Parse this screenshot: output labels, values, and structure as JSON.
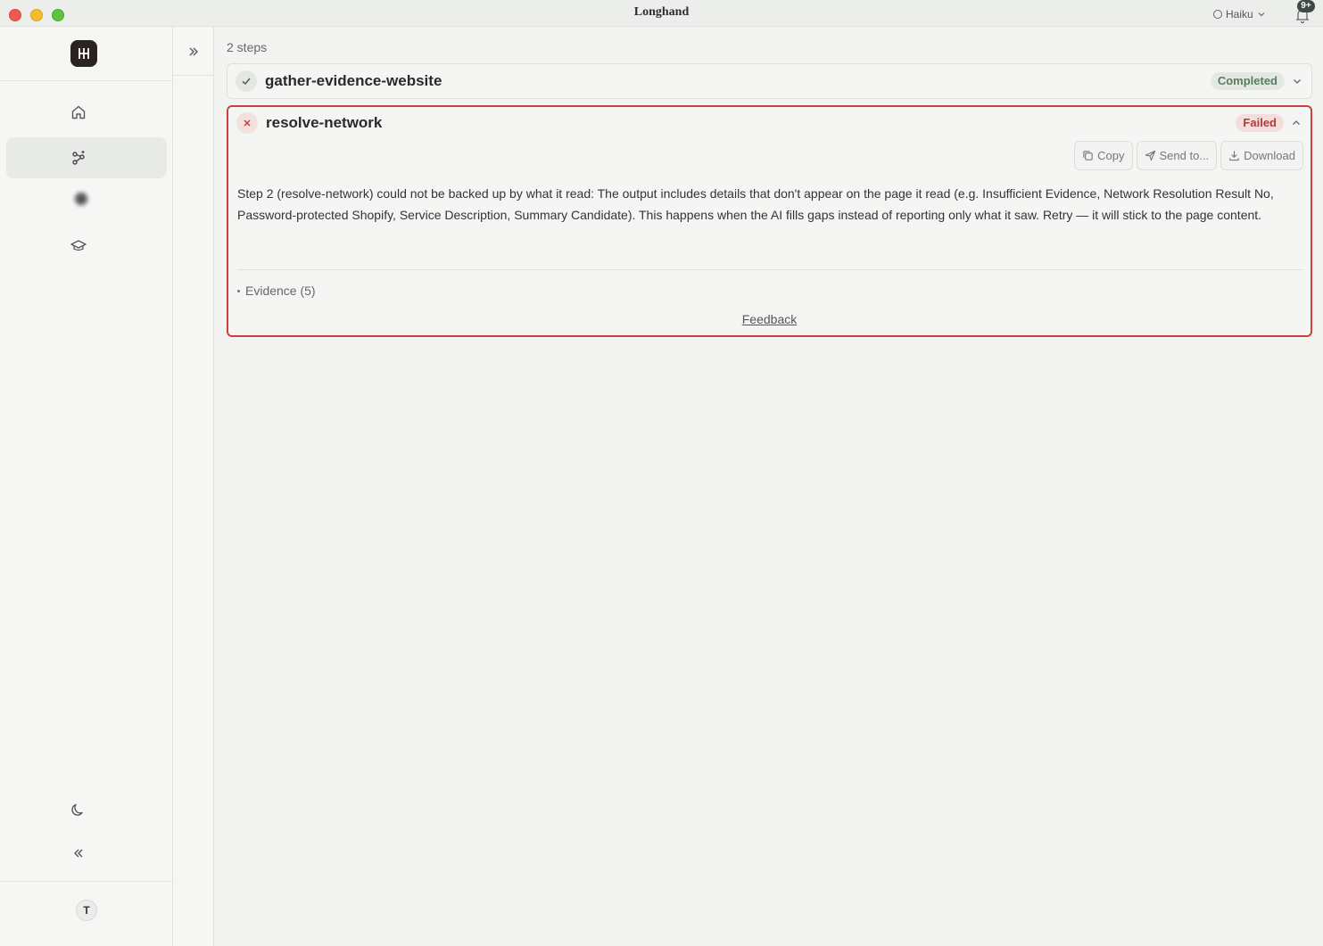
{
  "window": {
    "title": "Longhand",
    "model_selector": "Haiku",
    "notifications_badge": "9+"
  },
  "sidebar": {
    "logo_icon": "longhand-logo",
    "items": [
      {
        "name": "home",
        "icon": "home-icon",
        "active": false
      },
      {
        "name": "workflows",
        "icon": "sparkle-network-icon",
        "active": true
      },
      {
        "name": "blurred",
        "icon": "blurred-icon",
        "active": false
      },
      {
        "name": "learn",
        "icon": "graduation-cap-icon",
        "active": false
      }
    ],
    "theme_toggle_icon": "moon-icon",
    "collapse_icon": "chevrons-left-icon",
    "avatar_initial": "T"
  },
  "main": {
    "steps_count": "2 steps",
    "steps": [
      {
        "name": "gather-evidence-website",
        "status": "Completed",
        "expanded": false
      },
      {
        "name": "resolve-network",
        "status": "Failed",
        "expanded": true,
        "actions": {
          "copy": "Copy",
          "send": "Send to...",
          "download": "Download"
        },
        "error_message": "Step 2 (resolve-network) could not be backed up by what it read: The output includes details that don't appear on the page it read (e.g. Insufficient Evidence, Network Resolution Result No, Password-protected Shopify, Service Description, Summary Candidate). This happens when the AI fills gaps instead of reporting only what it saw. Retry — it will stick to the page content.",
        "evidence_label": "Evidence (5)",
        "feedback_label": "Feedback"
      }
    ]
  },
  "colors": {
    "success": "#5a7c5e",
    "danger": "#c9413d",
    "background": "#f3f4f2"
  }
}
